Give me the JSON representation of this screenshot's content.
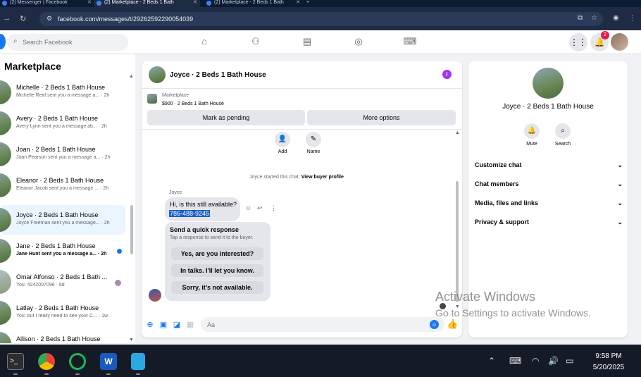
{
  "browser": {
    "tabs": [
      {
        "label": "(2) Messenger | Facebook"
      },
      {
        "label": "(2) Marketplace - 2 Beds 1 Bath"
      },
      {
        "label": "(2) Marketplace - 2 Beds 1 Bath"
      }
    ],
    "url": "facebook.com/messages/t/29262592290054039"
  },
  "fb_header": {
    "search_placeholder": "Search Facebook",
    "notification_count": "2"
  },
  "sidebar": {
    "title": "Marketplace",
    "conversations": [
      {
        "name": "Michelle · 2 Beds 1 Bath House",
        "snippet": "Michelle Reid sent you a message a... · 2h",
        "unread": false,
        "selected": false
      },
      {
        "name": "Avery · 2 Beds 1 Bath House",
        "snippet": "Avery Lynn sent you a message ab... · 2h",
        "unread": false,
        "selected": false
      },
      {
        "name": "Joan · 2 Beds 1 Bath House",
        "snippet": "Joan Pearson sent you a message a... · 2h",
        "unread": false,
        "selected": false
      },
      {
        "name": "Eleanor · 2 Beds 1 Bath House",
        "snippet": "Eleanor Jacob sent you a message ... · 2h",
        "unread": false,
        "selected": false
      },
      {
        "name": "Joyce · 2 Beds 1 Bath House",
        "snippet": "Joyce Freeman sent you a message... · 2h",
        "unread": false,
        "selected": true
      },
      {
        "name": "Jane · 2 Beds 1 Bath House",
        "snippet": "Jane Hunt sent you a message a... · 2h",
        "unread": true,
        "selected": false
      },
      {
        "name": "Omar Alfonso · 2 Beds 1 Bath ...",
        "snippet": "You: 4242007096 · 6d",
        "unread": false,
        "selected": false
      },
      {
        "name": "Latlay · 2 Beds 1 Bath House",
        "snippet": "You: but I really need to see your C... · 1w",
        "unread": false,
        "selected": false
      },
      {
        "name": "Allison · 2 Beds 1 Bath House",
        "snippet": "",
        "unread": false,
        "selected": false
      }
    ]
  },
  "chat": {
    "title": "Joyce · 2 Beds 1 Bath House",
    "marketplace_label": "Marketplace",
    "listing": "$900 · 2 Beds 1 Bath House",
    "mark_pending": "Mark as pending",
    "more_options": "More options",
    "actions": [
      {
        "label": "Add"
      },
      {
        "label": "Name"
      }
    ],
    "started_text": "Joyce started this chat. ",
    "view_buyer": "View buyer profile",
    "sender": "Joyce",
    "message_line1": "Hi, is this still available?",
    "message_line2": "786-488-9245",
    "quick_response_title": "Send a quick response",
    "quick_response_sub": "Tap a response to send it to the buyer.",
    "quick_responses": [
      "Yes, are you interested?",
      "In talks. I'll let you know.",
      "Sorry, it's not available."
    ],
    "input_placeholder": "Aa"
  },
  "details": {
    "name": "Joyce · 2 Beds 1 Bath House",
    "mute": "Mute",
    "search": "Search",
    "sections": [
      "Customize chat",
      "Chat members",
      "Media, files and links",
      "Privacy & support"
    ]
  },
  "watermark": {
    "line1": "Activate Windows",
    "line2": "Go to Settings to activate Windows."
  },
  "taskbar": {
    "time": "9:58 PM",
    "date": "5/20/2025"
  },
  "colors": {
    "fb_blue": "#1877f2",
    "selected_bg": "#ebf5ff",
    "info_purple": "#a334fa",
    "badge_red": "#e41e3f"
  }
}
